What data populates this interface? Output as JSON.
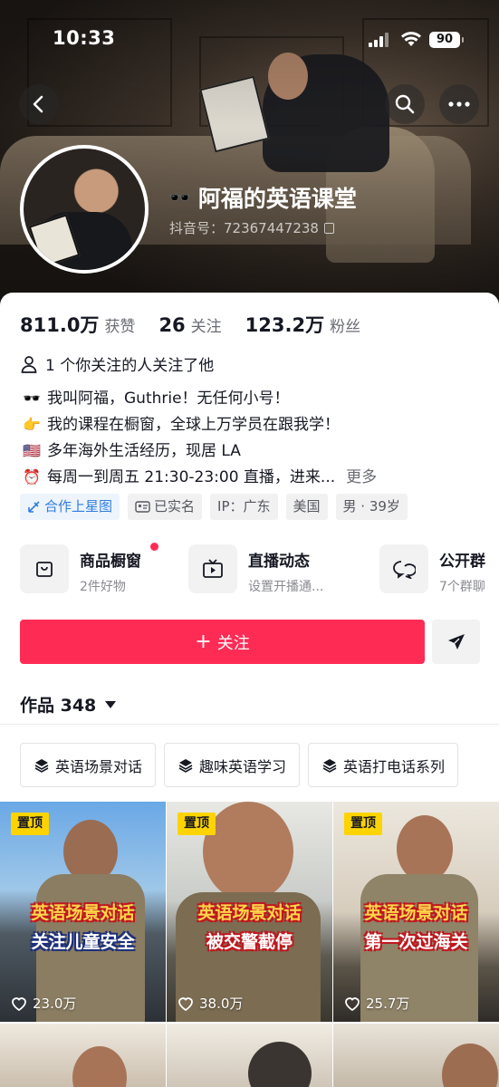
{
  "status_bar": {
    "time": "10:33",
    "battery": "90"
  },
  "profile": {
    "name": "阿福的英语课堂",
    "name_emoji": "🕶️",
    "douyin_id": "抖音号：72367447238"
  },
  "stats": [
    {
      "value": "811.0万",
      "label": "获赞"
    },
    {
      "value": "26",
      "label": "关注"
    },
    {
      "value": "123.2万",
      "label": "粉丝"
    }
  ],
  "mutual_follow": "1 个你关注的人关注了他",
  "bio": [
    {
      "emoji": "🕶️",
      "text": "我叫阿福，Guthrie！无任何小号！"
    },
    {
      "emoji": "👉",
      "text": "我的课程在橱窗，全球上万学员在跟我学！"
    },
    {
      "emoji": "🇺🇸",
      "text": "多年海外生活经历，现居 LA"
    },
    {
      "emoji": "⏰",
      "text": "每周一到周五 21:30-23:00 直播，进来...",
      "more": "更多"
    }
  ],
  "tags": [
    "合作上星图",
    "已实名",
    "IP：广东",
    "美国",
    "男 · 39岁"
  ],
  "services": [
    {
      "title": "商品橱窗",
      "sub": "2件好物"
    },
    {
      "title": "直播动态",
      "sub": "设置开播通..."
    },
    {
      "title": "公开群",
      "sub": "7个群聊"
    }
  ],
  "follow_button": "关注",
  "works_tab": "作品 348",
  "collections": [
    "英语场景对话",
    "趣味英语学习",
    "英语打电话系列"
  ],
  "videos": [
    {
      "pin": "置顶",
      "line1": "英语场景对话",
      "line2": "关注儿童安全",
      "likes": "23.0万"
    },
    {
      "pin": "置顶",
      "line1": "英语场景对话",
      "line2": "被交警截停",
      "likes": "38.0万"
    },
    {
      "pin": "置顶",
      "line1": "英语场景对话",
      "line2": "第一次过海关",
      "likes": "25.7万"
    }
  ],
  "colors": {
    "accent": "#fe2c55",
    "pin": "#fdd400",
    "tag_blue": "#2f7de1"
  }
}
